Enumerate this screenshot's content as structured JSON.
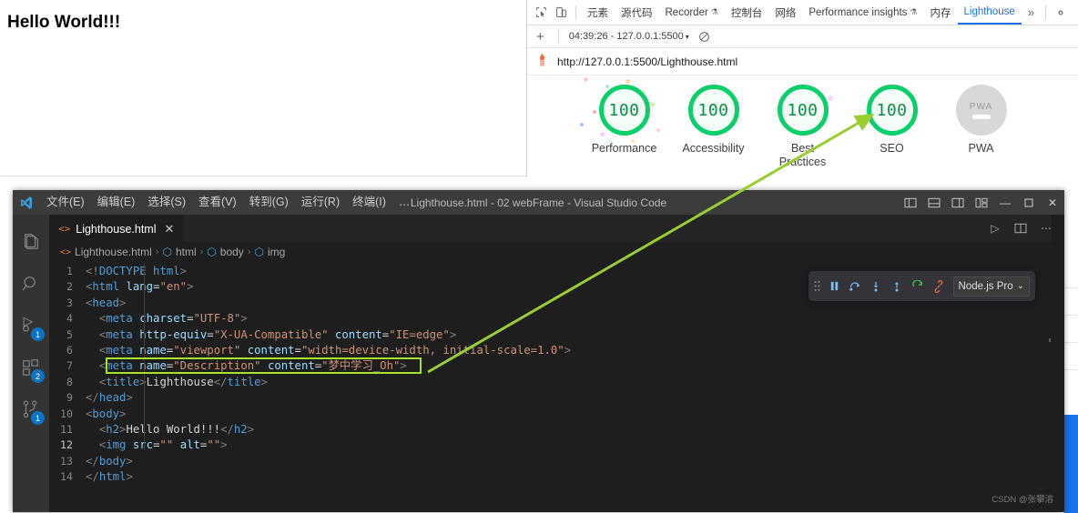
{
  "page": {
    "heading": "Hello World!!!"
  },
  "devtools": {
    "icons": {
      "inspect": "inspect-element-icon",
      "device": "device-toolbar-icon",
      "settings": "gear-icon",
      "kebab": "more-options-icon",
      "overflow": "overflow-chevron-icon"
    },
    "tabs": [
      {
        "label": "元素",
        "active": false,
        "warning": false
      },
      {
        "label": "源代码",
        "active": false,
        "warning": false
      },
      {
        "label": "Recorder",
        "active": false,
        "warning": true
      },
      {
        "label": "控制台",
        "active": false,
        "warning": false
      },
      {
        "label": "网络",
        "active": false,
        "warning": false
      },
      {
        "label": "Performance insights",
        "active": false,
        "warning": true
      },
      {
        "label": "内存",
        "active": false,
        "warning": false
      },
      {
        "label": "Lighthouse",
        "active": true,
        "warning": false
      }
    ],
    "overflow_label": "»",
    "subbar": {
      "new_run_label": "+",
      "run_label": "04:39:26 - 127.0.0.1:5500",
      "caret": "▾",
      "clear_icon": "clear-all-icon"
    },
    "url": "http://127.0.0.1:5500/Lighthouse.html",
    "url_icon": "lighthouse-icon"
  },
  "lighthouse": {
    "gauges": [
      {
        "score": "100",
        "label": "Performance",
        "state": "pass"
      },
      {
        "score": "100",
        "label": "Accessibility",
        "state": "pass"
      },
      {
        "score": "100",
        "label": "Best Practices",
        "state": "pass"
      },
      {
        "score": "100",
        "label": "SEO",
        "state": "pass"
      },
      {
        "score": "PWA",
        "label": "PWA",
        "state": "na"
      }
    ],
    "pass_color": "#0cce6b",
    "na_color": "#d8d8d8"
  },
  "vscode": {
    "title": "Lighthouse.html - 02 webFrame - Visual Studio Code",
    "logo_icon": "vscode-logo-icon",
    "menus": [
      "文件(E)",
      "编辑(E)",
      "选择(S)",
      "查看(V)",
      "转到(G)",
      "运行(R)",
      "终端(I)",
      "…"
    ],
    "window_controls": [
      {
        "name": "toggle-primary-sidebar-icon",
        "glyph": "▯▯"
      },
      {
        "name": "toggle-panel-icon",
        "glyph": "▤"
      },
      {
        "name": "toggle-secondary-sidebar-icon",
        "glyph": "▯▯"
      },
      {
        "name": "customize-layout-icon",
        "glyph": "▥"
      },
      {
        "name": "minimize-button",
        "glyph": "—"
      },
      {
        "name": "maximize-button",
        "glyph": "▢"
      },
      {
        "name": "close-button",
        "glyph": "✕"
      }
    ],
    "activity_bar": [
      {
        "name": "explorer",
        "icon": "files-icon",
        "badge": ""
      },
      {
        "name": "search",
        "icon": "search-icon",
        "badge": ""
      },
      {
        "name": "run-and-debug",
        "icon": "debug-icon",
        "badge": "1"
      },
      {
        "name": "extensions",
        "icon": "extensions-icon",
        "badge": "2"
      },
      {
        "name": "source-control",
        "icon": "source-control-icon",
        "badge": "1"
      }
    ],
    "tab": {
      "filename": "Lighthouse.html",
      "file_icon": "html-file-icon",
      "close_glyph": "✕"
    },
    "tab_actions": [
      {
        "name": "run-code-button",
        "glyph": "▷"
      },
      {
        "name": "split-editor-button",
        "glyph": "▯▯"
      },
      {
        "name": "more-actions-button",
        "glyph": "⋯"
      }
    ],
    "breadcrumb": [
      {
        "label": "Lighthouse.html",
        "icon": "html-file-icon"
      },
      {
        "label": "html",
        "icon": "symbol-field-icon"
      },
      {
        "label": "body",
        "icon": "symbol-field-icon"
      },
      {
        "label": "img",
        "icon": "symbol-field-icon"
      }
    ],
    "breadcrumb_separator": "›",
    "debug_toolbar": {
      "drag_handle_icon": "drag-handle-icon",
      "buttons": [
        {
          "name": "pause-button",
          "icon": "pause-icon"
        },
        {
          "name": "step-over-button",
          "icon": "step-over-icon"
        },
        {
          "name": "step-into-button",
          "icon": "step-into-icon"
        },
        {
          "name": "step-out-button",
          "icon": "step-out-icon"
        },
        {
          "name": "restart-button",
          "icon": "restart-icon"
        },
        {
          "name": "disconnect-button",
          "icon": "disconnect-icon"
        }
      ],
      "session_label": "Node.js Pro",
      "session_caret": "⌄"
    },
    "code": {
      "lines": [
        {
          "n": "1",
          "current": false
        },
        {
          "n": "2",
          "current": false
        },
        {
          "n": "3",
          "current": false
        },
        {
          "n": "4",
          "current": false
        },
        {
          "n": "5",
          "current": false
        },
        {
          "n": "6",
          "current": false
        },
        {
          "n": "7",
          "current": false
        },
        {
          "n": "8",
          "current": false
        },
        {
          "n": "9",
          "current": false
        },
        {
          "n": "10",
          "current": false
        },
        {
          "n": "11",
          "current": false
        },
        {
          "n": "12",
          "current": true
        },
        {
          "n": "13",
          "current": false
        },
        {
          "n": "14",
          "current": false
        }
      ],
      "text": [
        "<!DOCTYPE html>",
        "<html lang=\"en\">",
        "<head>",
        "  <meta charset=\"UTF-8\">",
        "  <meta http-equiv=\"X-UA-Compatible\" content=\"IE=edge\">",
        "  <meta name=\"viewport\" content=\"width=device-width, initial-scale=1.0\">",
        "  <meta name=\"Description\" content=\"梦中学习_Oh\">",
        "  <title>Lighthouse</title>",
        "</head>",
        "<body>",
        "  <h2>Hello World!!!</h2>",
        "  <img src=\"\" alt=\"\">",
        "</body>",
        "</html>"
      ]
    }
  },
  "annotation": {
    "arrow_color": "#9acd32",
    "highlight_color": "#a6e22e",
    "highlight_target_line": "7",
    "arrow_points_to": "SEO"
  },
  "watermark": "CSDN @张攀溶"
}
